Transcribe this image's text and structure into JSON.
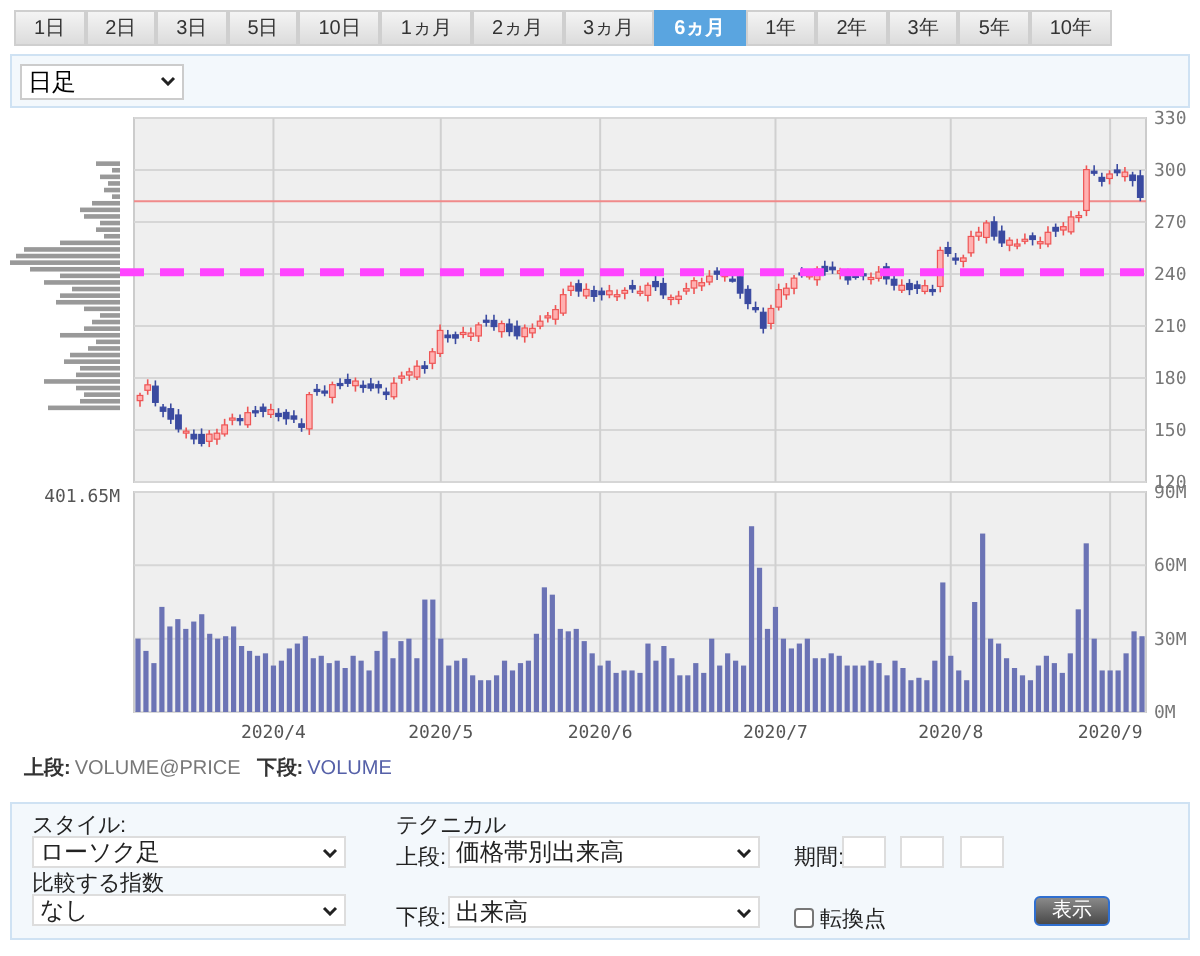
{
  "period_tabs": [
    {
      "label": "1日",
      "selected": false
    },
    {
      "label": "2日",
      "selected": false
    },
    {
      "label": "3日",
      "selected": false
    },
    {
      "label": "5日",
      "selected": false
    },
    {
      "label": "10日",
      "selected": false
    },
    {
      "label": "1ヵ月",
      "selected": false
    },
    {
      "label": "2ヵ月",
      "selected": false
    },
    {
      "label": "3ヵ月",
      "selected": false
    },
    {
      "label": "6ヵ月",
      "selected": true
    },
    {
      "label": "1年",
      "selected": false
    },
    {
      "label": "2年",
      "selected": false
    },
    {
      "label": "3年",
      "selected": false
    },
    {
      "label": "5年",
      "selected": false
    },
    {
      "label": "10年",
      "selected": false
    }
  ],
  "interval_select": {
    "value": "日足"
  },
  "price_chart": {
    "y_axis_labels": [
      "330",
      "300",
      "270",
      "240",
      "210",
      "180",
      "150",
      "120"
    ]
  },
  "volume_chart": {
    "max_label": "401.65M",
    "x_axis_labels": [
      "2020/4",
      "2020/5",
      "2020/6",
      "2020/7",
      "2020/8",
      "2020/9"
    ],
    "chart_data": {
      "type": "bar",
      "ylim": [
        0,
        90
      ],
      "yticks": [
        {
          "value": 0,
          "label": "0M"
        },
        {
          "value": 30,
          "label": "30M"
        },
        {
          "value": 60,
          "label": "60M"
        },
        {
          "value": 90,
          "label": "90M"
        }
      ],
      "values": [
        30,
        25,
        20,
        43,
        35,
        38,
        34,
        37,
        40,
        32,
        30,
        31,
        35,
        27,
        25,
        23,
        24,
        19,
        21,
        26,
        28,
        31,
        22,
        23,
        20,
        21,
        18,
        23,
        21,
        17,
        25,
        33,
        22,
        29,
        30,
        22,
        46,
        46,
        30,
        19,
        21,
        22,
        15,
        13,
        13,
        15,
        21,
        17,
        20,
        21,
        32,
        51,
        48,
        34,
        33,
        34,
        29,
        24,
        19,
        21,
        16,
        17,
        17,
        16,
        28,
        21,
        27,
        22,
        15,
        15,
        20,
        16,
        30,
        19,
        24,
        21,
        19,
        76,
        59,
        34,
        43,
        30,
        26,
        28,
        30,
        22,
        22,
        24,
        23,
        19,
        19,
        19,
        21,
        20,
        15,
        21,
        18,
        13,
        14,
        13,
        21,
        53,
        23,
        17,
        13,
        45,
        73,
        30,
        28,
        22,
        18,
        15,
        13,
        19,
        23,
        20,
        16,
        24,
        42,
        69,
        30,
        17,
        17,
        17,
        24,
        33,
        31
      ]
    }
  },
  "legend": {
    "upper_label": "上段:",
    "upper_value": "VOLUME@PRICE",
    "lower_label": "下段:",
    "lower_value": "VOLUME"
  },
  "settings": {
    "style_label": "スタイル:",
    "style_value": "ローソク足",
    "compare_label": "比較する指数",
    "compare_value": "なし",
    "technical_label": "テクニカル",
    "upper_label": "上段:",
    "upper_value": "価格帯別出来高",
    "lower_label": "下段:",
    "lower_value": "出来高",
    "period_label": "期間:",
    "turning_point": {
      "label": "転換点",
      "checked": false
    },
    "submit_button": "表示"
  }
}
